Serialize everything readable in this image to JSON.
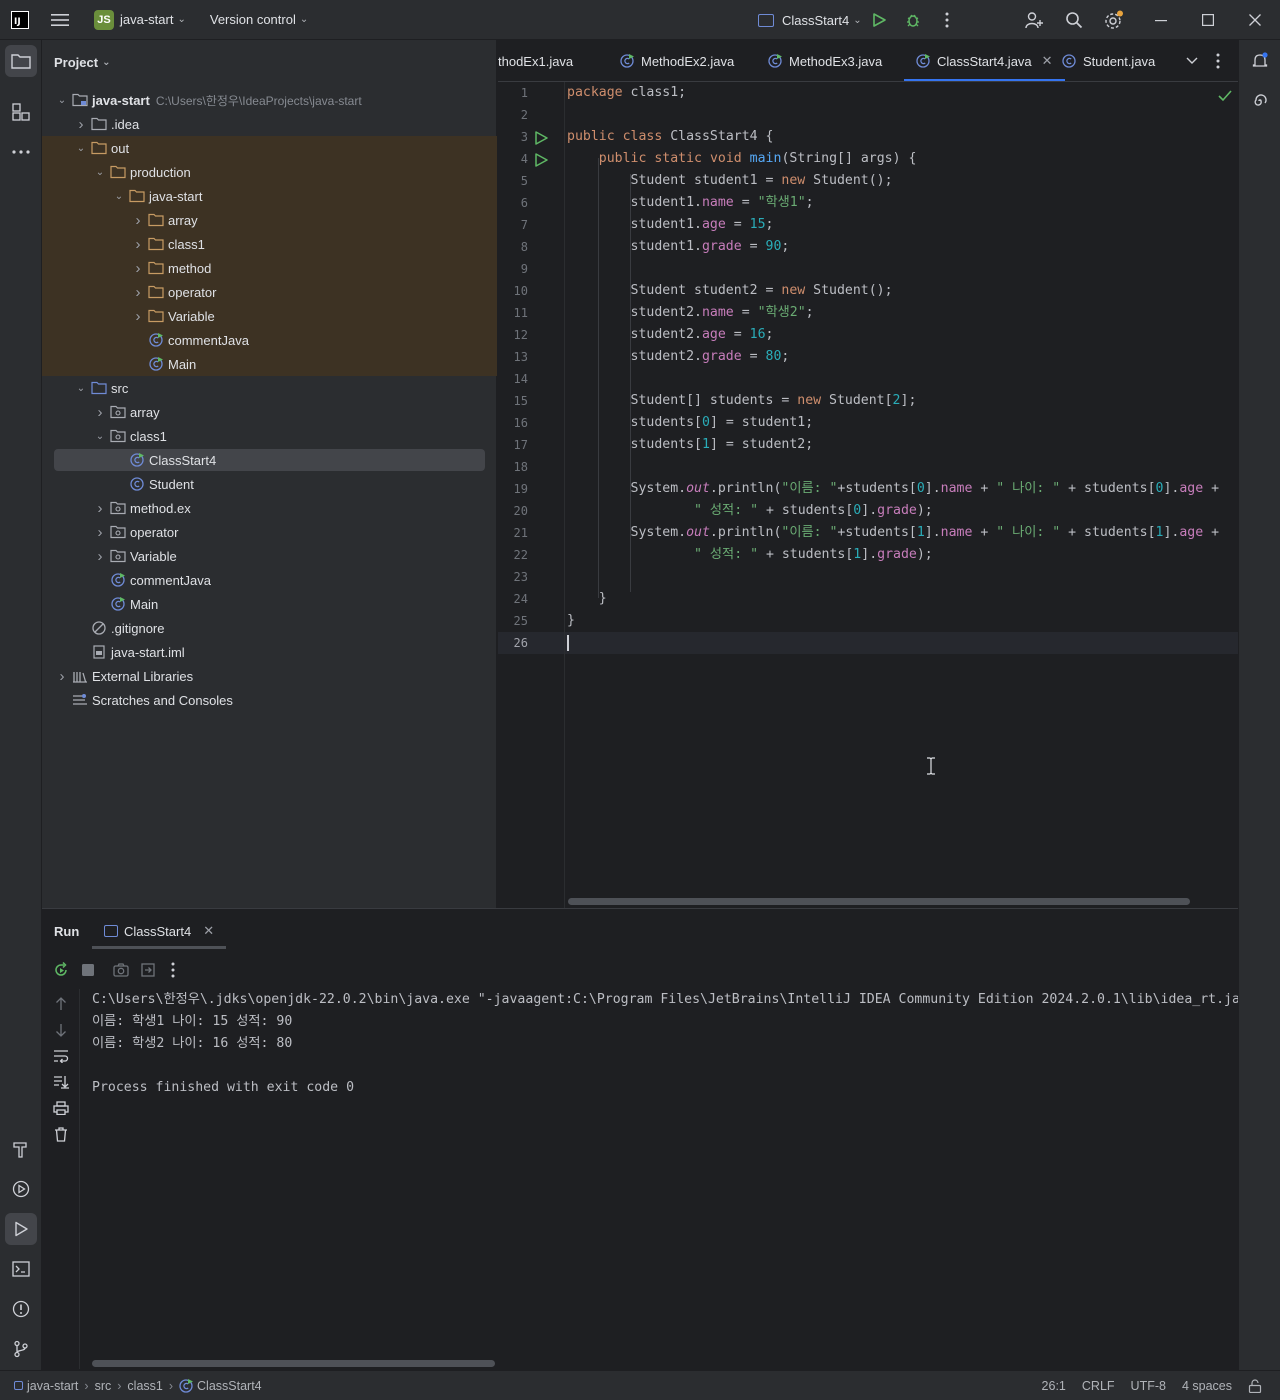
{
  "titlebar": {
    "logo_text": "IJ",
    "project_badge": "JS",
    "project_name": "java-start",
    "version_control": "Version control",
    "run_config": "ClassStart4"
  },
  "project_panel": {
    "title": "Project",
    "tree": [
      {
        "label": "java-start",
        "path": "C:\\Users\\한정우\\IdeaProjects\\java-start",
        "depth": 0,
        "expanded": true,
        "icon": "module-folder-icon"
      },
      {
        "label": ".idea",
        "depth": 1,
        "expanded": false,
        "icon": "folder-icon"
      },
      {
        "label": "out",
        "depth": 1,
        "expanded": true,
        "icon": "folder-orange-icon",
        "excluded": true
      },
      {
        "label": "production",
        "depth": 2,
        "expanded": true,
        "icon": "folder-orange-icon",
        "excluded": true
      },
      {
        "label": "java-start",
        "depth": 3,
        "expanded": true,
        "icon": "folder-orange-icon",
        "excluded": true
      },
      {
        "label": "array",
        "depth": 4,
        "expanded": false,
        "icon": "folder-orange-icon",
        "excluded": true
      },
      {
        "label": "class1",
        "depth": 4,
        "expanded": false,
        "icon": "folder-orange-icon",
        "excluded": true
      },
      {
        "label": "method",
        "depth": 4,
        "expanded": false,
        "icon": "folder-orange-icon",
        "excluded": true
      },
      {
        "label": "operator",
        "depth": 4,
        "expanded": false,
        "icon": "folder-orange-icon",
        "excluded": true
      },
      {
        "label": "Variable",
        "depth": 4,
        "expanded": false,
        "icon": "folder-orange-icon",
        "excluded": true
      },
      {
        "label": "commentJava",
        "depth": 4,
        "leaf": true,
        "icon": "java-class-run-icon",
        "excluded": true
      },
      {
        "label": "Main",
        "depth": 4,
        "leaf": true,
        "icon": "java-class-run-icon",
        "excluded": true
      },
      {
        "label": "src",
        "depth": 1,
        "expanded": true,
        "icon": "source-folder-icon"
      },
      {
        "label": "array",
        "depth": 2,
        "expanded": false,
        "icon": "package-icon"
      },
      {
        "label": "class1",
        "depth": 2,
        "expanded": true,
        "icon": "package-icon"
      },
      {
        "label": "ClassStart4",
        "depth": 3,
        "leaf": true,
        "icon": "java-class-run-icon",
        "selected": true
      },
      {
        "label": "Student",
        "depth": 3,
        "leaf": true,
        "icon": "java-class-icon"
      },
      {
        "label": "method.ex",
        "depth": 2,
        "expanded": false,
        "icon": "package-icon"
      },
      {
        "label": "operator",
        "depth": 2,
        "expanded": false,
        "icon": "package-icon"
      },
      {
        "label": "Variable",
        "depth": 2,
        "expanded": false,
        "icon": "package-icon"
      },
      {
        "label": "commentJava",
        "depth": 2,
        "leaf": true,
        "icon": "java-class-run-icon"
      },
      {
        "label": "Main",
        "depth": 2,
        "leaf": true,
        "icon": "java-class-run-icon"
      },
      {
        "label": ".gitignore",
        "depth": 1,
        "leaf": true,
        "icon": "ignore-file-icon"
      },
      {
        "label": "java-start.iml",
        "depth": 1,
        "leaf": true,
        "icon": "iml-file-icon"
      },
      {
        "label": "External Libraries",
        "depth": 0,
        "expanded": false,
        "icon": "library-icon"
      },
      {
        "label": "Scratches and Consoles",
        "depth": 0,
        "leaf": true,
        "icon": "scratches-icon"
      }
    ]
  },
  "editor": {
    "tabs": [
      {
        "label": "thodEx1.java",
        "active": false
      },
      {
        "label": "MethodEx2.java",
        "active": false
      },
      {
        "label": "MethodEx3.java",
        "active": false
      },
      {
        "label": "ClassStart4.java",
        "active": true,
        "closable": true
      },
      {
        "label": "Student.java",
        "active": false
      }
    ],
    "current_line": 26,
    "lines": [
      "package class1;",
      "",
      "public class ClassStart4 {",
      "    public static void main(String[] args) {",
      "        Student student1 = new Student();",
      "        student1.name = \"학생1\";",
      "        student1.age = 15;",
      "        student1.grade = 90;",
      "",
      "        Student student2 = new Student();",
      "        student2.name = \"학생2\";",
      "        student2.age = 16;",
      "        student2.grade = 80;",
      "",
      "        Student[] students = new Student[2];",
      "        students[0] = student1;",
      "        students[1] = student2;",
      "",
      "        System.out.println(\"이름: \"+students[0].name + \" 나이: \" + students[0].age +",
      "                \" 성적: \" + students[0].grade);",
      "        System.out.println(\"이름: \"+students[1].name + \" 나이: \" + students[1].age +",
      "                \" 성적: \" + students[1].grade);",
      "",
      "    }",
      "}",
      ""
    ]
  },
  "run_panel": {
    "title": "Run",
    "tab_label": "ClassStart4",
    "console": [
      "C:\\Users\\한정우\\.jdks\\openjdk-22.0.2\\bin\\java.exe \"-javaagent:C:\\Program Files\\JetBrains\\IntelliJ IDEA Community Edition 2024.2.0.1\\lib\\idea_rt.jar",
      "이름: 학생1 나이: 15 성적: 90",
      "이름: 학생2 나이: 16 성적: 80",
      "",
      "Process finished with exit code 0"
    ]
  },
  "statusbar": {
    "breadcrumb": [
      "java-start",
      "src",
      "class1",
      "ClassStart4"
    ],
    "position": "26:1",
    "line_separator": "CRLF",
    "encoding": "UTF-8",
    "indent": "4 spaces"
  },
  "colors": {
    "accent": "#3574f0",
    "background": "#1e1f22",
    "panel": "#2b2d30",
    "excluded_bg": "#3d3223",
    "run_green": "#5fb865"
  }
}
